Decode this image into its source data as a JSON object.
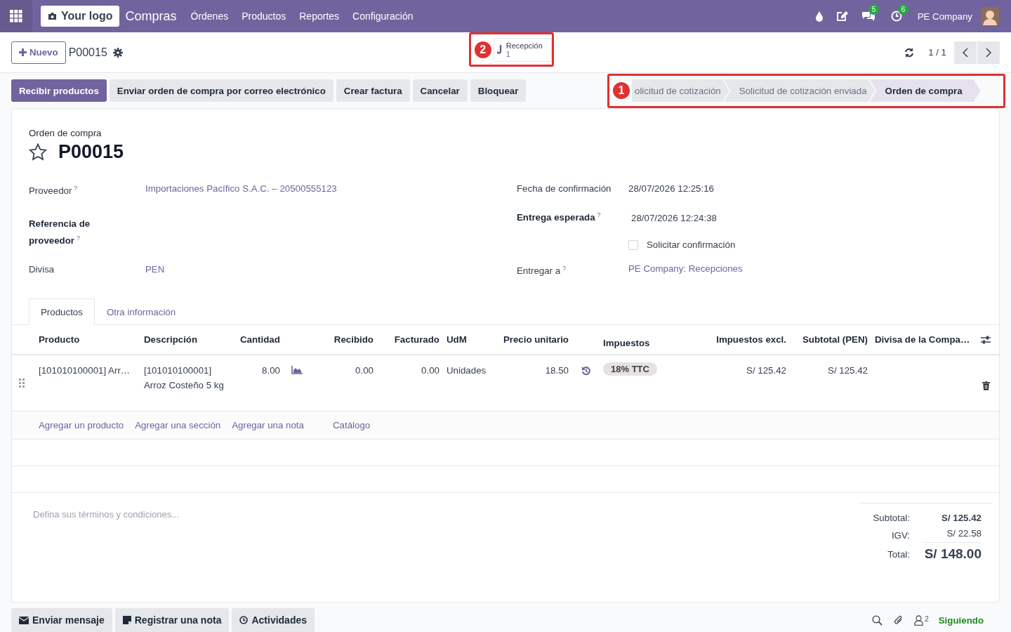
{
  "navbar": {
    "logo": "Your logo",
    "app": "Compras",
    "menu": [
      "Órdenes",
      "Productos",
      "Reportes",
      "Configuración"
    ],
    "badges": [
      {
        "kind": "chat",
        "count": "5"
      },
      {
        "kind": "activity",
        "count": "6"
      }
    ],
    "company": "PE Company"
  },
  "control_panel": {
    "new_button": "Nuevo",
    "record": "P00015",
    "smart_button": {
      "label": "Recepción",
      "value": "1",
      "annotation": "2"
    },
    "pager": "1 / 1"
  },
  "actions": [
    {
      "label": "Recibir productos",
      "primary": true
    },
    {
      "label": "Enviar orden de compra por correo electrónico",
      "primary": false
    },
    {
      "label": "Crear factura",
      "primary": false
    },
    {
      "label": "Cancelar",
      "primary": false
    },
    {
      "label": "Bloquear",
      "primary": false
    }
  ],
  "statusbar": {
    "annotation": "1",
    "steps": [
      {
        "label": "olicitud de cotización",
        "selected": false
      },
      {
        "label": "Solicitud de cotización enviada",
        "selected": false
      },
      {
        "label": "Orden de compra",
        "selected": true
      }
    ]
  },
  "form": {
    "type_label": "Orden de compra",
    "name": "P00015",
    "starred": false,
    "left_fields": [
      {
        "label": "Proveedor",
        "required": false,
        "help": "?",
        "kind": "link",
        "value": "Importaciones Pacífico S.A.C. – 20500555123"
      },
      {
        "label": "Referencia de proveedor",
        "required": true,
        "help": "?",
        "kind": "empty"
      },
      {
        "label": "Divisa",
        "required": false,
        "kind": "link",
        "value": "PEN"
      }
    ],
    "right_fields": [
      {
        "label": "Fecha de confirmación",
        "required": false,
        "kind": "text",
        "value": "28/07/2026 12:25:16"
      },
      {
        "label": "Entrega esperada",
        "required": true,
        "help": "?",
        "kind": "text",
        "value": "28/07/2026 12:24:38"
      },
      {
        "kind": "checkbox",
        "value": "Solicitar confirmación",
        "checked": false
      },
      {
        "label": "Entregar a",
        "required": false,
        "help": "?",
        "kind": "link",
        "value": "PE Company: Recepciones"
      }
    ]
  },
  "tabs": [
    {
      "label": "Productos",
      "selected": true
    },
    {
      "label": "Otra información",
      "selected": false
    }
  ],
  "table": {
    "columns": [
      "Producto",
      "Descripción",
      "Cantidad",
      "Recibido",
      "Facturado",
      "UdM",
      "Precio unitario",
      "Impuestos",
      "Impuestos excl.",
      "Subtotal (PEN)",
      "Divisa de la Compa…"
    ],
    "rows": [
      {
        "product": "[101010100001] Arr…",
        "description": "[101010100001] Arroz Costeño 5 kg",
        "quantity": "8.00",
        "received": "0.00",
        "invoiced": "0.00",
        "uom": "Unidades",
        "price": "18.50",
        "tax": "18% TTC",
        "tax_excl": "S/ 125.42",
        "subtotal": "S/ 125.42"
      }
    ],
    "add_links": [
      "Agregar un producto",
      "Agregar una sección",
      "Agregar una nota",
      "Catálogo"
    ]
  },
  "terms": {
    "placeholder": "Defina sus términos y condiciones..."
  },
  "totals": [
    {
      "kind": "subtotal",
      "label": "Subtotal:",
      "value": "S/ 125.42"
    },
    {
      "kind": "tax",
      "label": "IGV:",
      "value": "S/ 22.58"
    },
    {
      "kind": "total",
      "label": "Total:",
      "value": "S/ 148.00"
    }
  ],
  "chatter": {
    "buttons": [
      {
        "kind": "message",
        "label": "Enviar mensaje"
      },
      {
        "kind": "note",
        "label": "Registrar una nota"
      },
      {
        "kind": "activity",
        "label": "Actividades"
      }
    ],
    "followers": "2",
    "follow": "Siguiendo"
  }
}
